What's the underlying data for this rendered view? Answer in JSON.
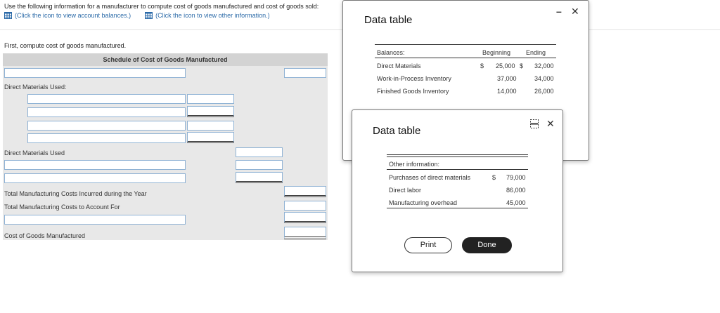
{
  "instructions": {
    "text": "Use the following information for a manufacturer to compute cost of goods manufactured and cost of goods sold:",
    "link1": "(Click the icon to view account balances.)",
    "link2": "(Click the icon to view other information.)"
  },
  "prompt": "First, compute cost of goods manufactured.",
  "schedule": {
    "title": "Schedule of Cost of Goods Manufactured",
    "labels": {
      "dm_used_header": "Direct Materials Used:",
      "dm_used": "Direct Materials Used",
      "total_incurred": "Total Manufacturing Costs Incurred during the Year",
      "total_account": "Total Manufacturing Costs to Account For",
      "cogm": "Cost of Goods Manufactured"
    }
  },
  "dialog1": {
    "title": "Data table",
    "minimize": "–",
    "close": "✕",
    "headers": {
      "label": "Balances:",
      "beginning": "Beginning",
      "ending": "Ending"
    },
    "rows": [
      {
        "label": "Direct Materials",
        "cur1": "$",
        "beginning": "25,000",
        "cur2": "$",
        "ending": "32,000"
      },
      {
        "label": "Work-in-Process Inventory",
        "cur1": "",
        "beginning": "37,000",
        "cur2": "",
        "ending": "34,000"
      },
      {
        "label": "Finished Goods Inventory",
        "cur1": "",
        "beginning": "14,000",
        "cur2": "",
        "ending": "26,000"
      }
    ]
  },
  "dialog2": {
    "title": "Data table",
    "close": "✕",
    "header": "Other information:",
    "rows": [
      {
        "label": "Purchases of direct materials",
        "cur": "$",
        "value": "79,000"
      },
      {
        "label": "Direct labor",
        "cur": "",
        "value": "86,000"
      },
      {
        "label": "Manufacturing overhead",
        "cur": "",
        "value": "45,000"
      }
    ],
    "print_label": "Print",
    "done_label": "Done"
  }
}
